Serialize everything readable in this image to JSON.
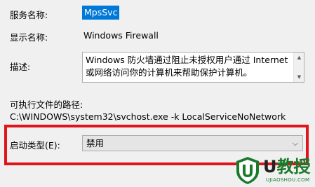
{
  "fields": {
    "service_name": {
      "label": "服务名称:",
      "value": "MpsSvc"
    },
    "display_name": {
      "label": "显示名称:",
      "value": "Windows Firewall"
    },
    "description": {
      "label": "描述:",
      "text": "Windows 防火墙通过阻止未授权用户通过 Internet\n或网络访问你的计算机来帮助保护计算机。"
    },
    "executable_path": {
      "label": "可执行文件的路径:",
      "value": "C:\\WINDOWS\\system32\\svchost.exe -k LocalServiceNoNetwork"
    },
    "startup_type": {
      "label": "启动类型(E):",
      "value": "禁用"
    }
  },
  "watermark": {
    "brand_letter": "U",
    "brand_text": "教授",
    "sub": "UJIAOSHOU.COM"
  },
  "colors": {
    "selection_bg": "#0078d7",
    "highlight_border": "#e0141b",
    "watermark_green": "#1a7a2b"
  }
}
